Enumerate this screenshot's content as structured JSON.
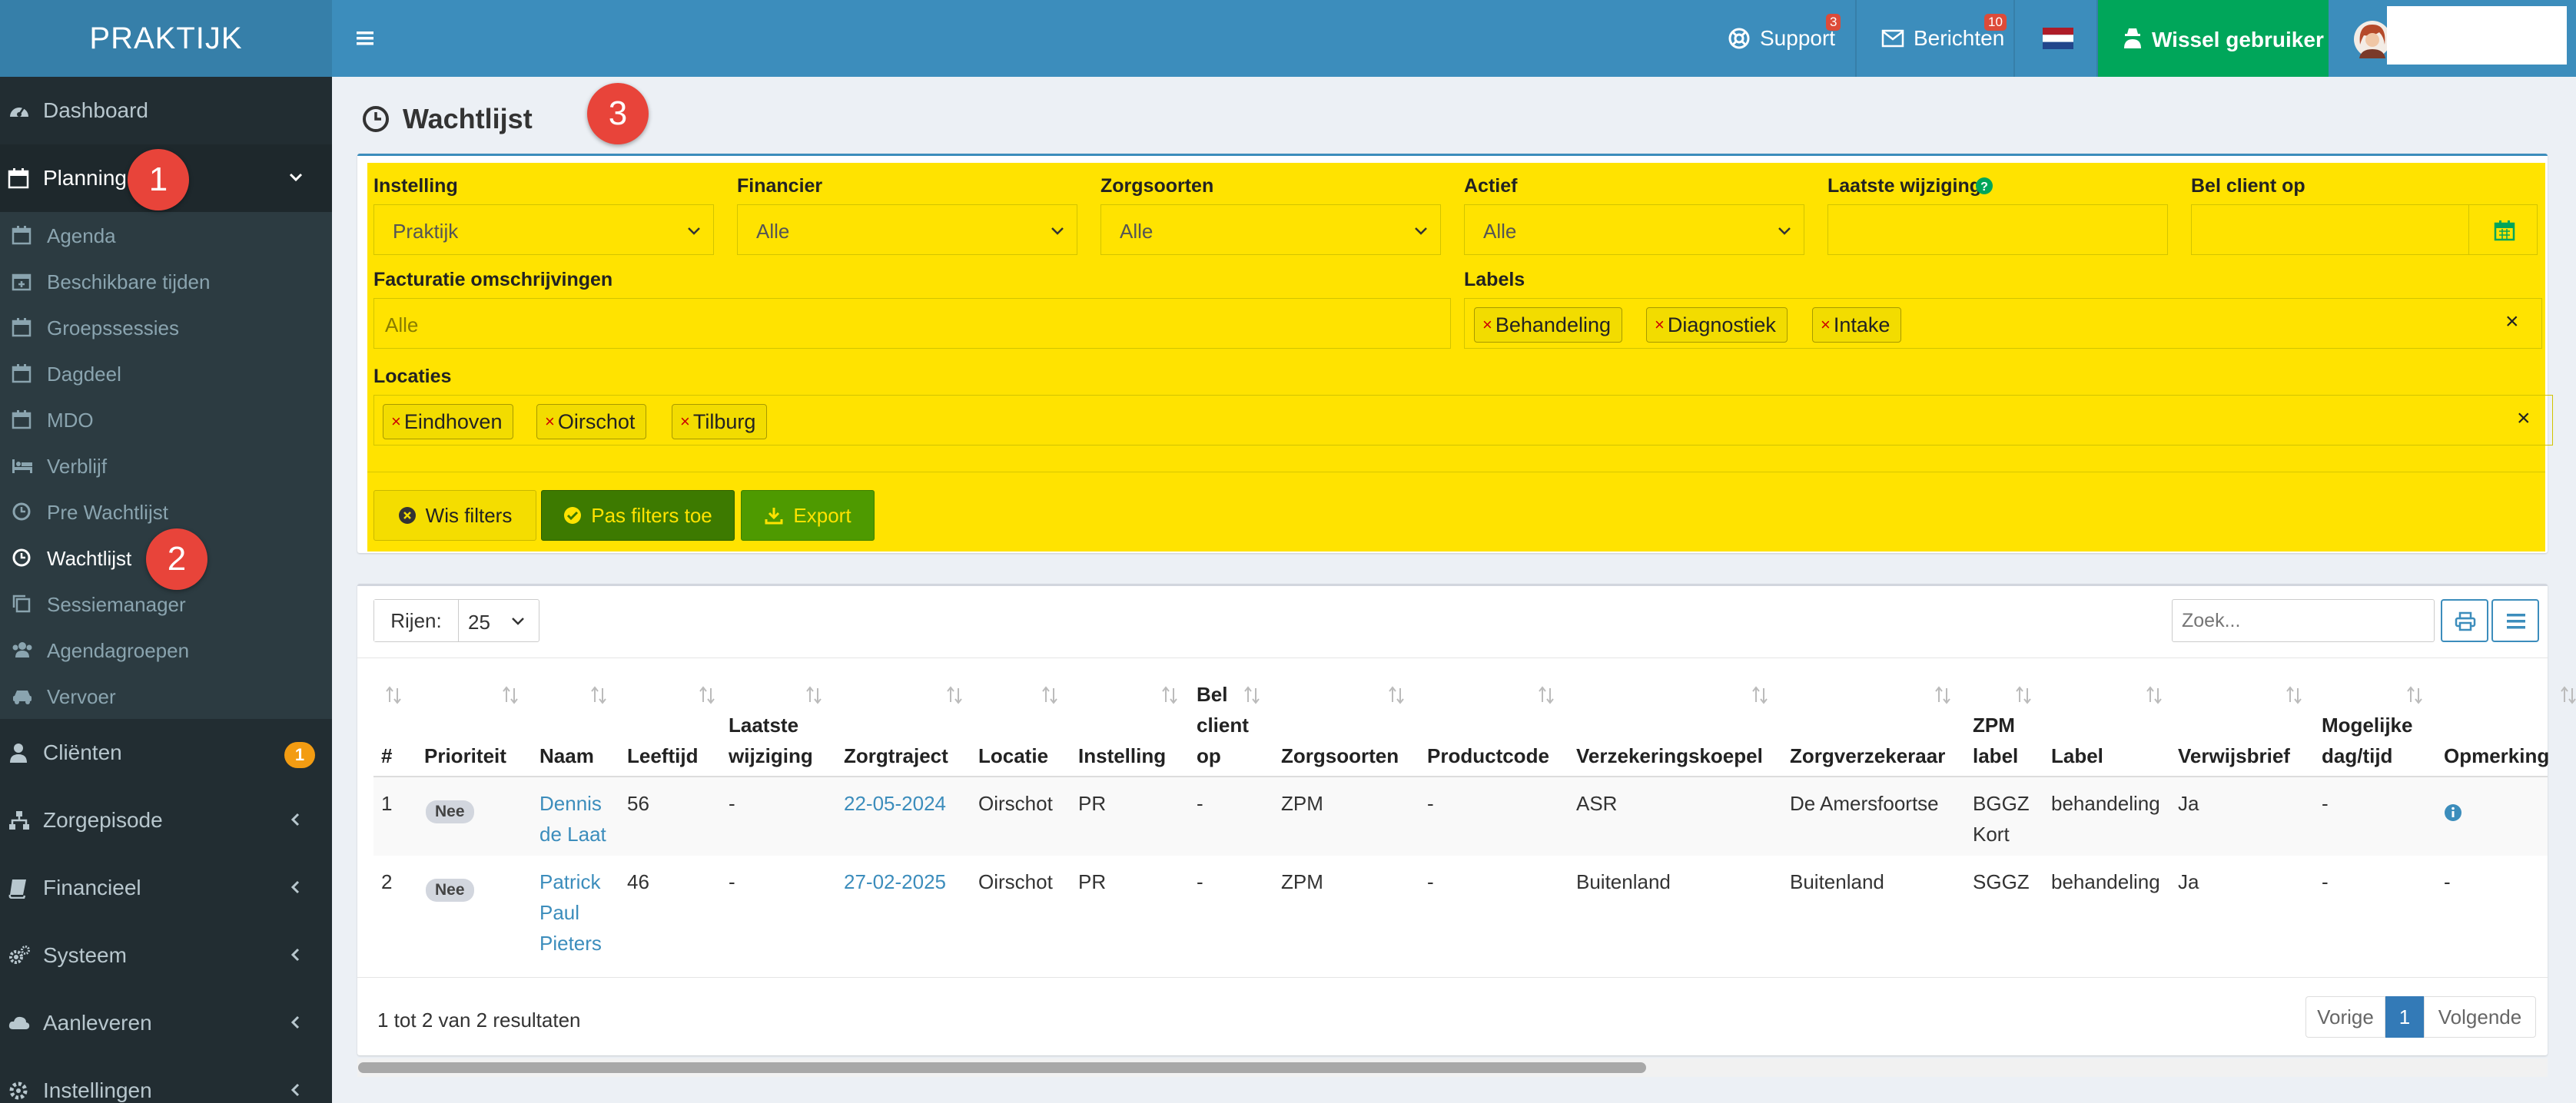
{
  "app": {
    "brand": "PRAKTIJK"
  },
  "colors": {
    "topbar": "#3c8dbc",
    "sidebar": "#222d32",
    "accent_green": "#00a65a",
    "highlight_yellow": "#ffe300",
    "marker_red": "#e8443a",
    "link_blue": "#3c8dbc"
  },
  "sidebar": {
    "top_items": [
      {
        "label": "Dashboard",
        "icon": "dashboard-icon"
      },
      {
        "label": "Planning",
        "icon": "calendar-icon",
        "expanded": true
      },
      {
        "label": "Cliënten",
        "icon": "user-icon",
        "badge": "1"
      },
      {
        "label": "Zorgepisode",
        "icon": "sitemap-icon"
      },
      {
        "label": "Financieel",
        "icon": "book-icon"
      },
      {
        "label": "Systeem",
        "icon": "cogs-icon"
      },
      {
        "label": "Aanleveren",
        "icon": "cloud-icon"
      },
      {
        "label": "Instellingen",
        "icon": "gear-icon"
      }
    ],
    "planning_items": [
      {
        "label": "Agenda",
        "icon": "calendar-icon"
      },
      {
        "label": "Beschikbare tijden",
        "icon": "calendar-plus-icon"
      },
      {
        "label": "Groepssessies",
        "icon": "calendar-icon"
      },
      {
        "label": "Dagdeel",
        "icon": "calendar-icon"
      },
      {
        "label": "MDO",
        "icon": "calendar-icon"
      },
      {
        "label": "Verblijf",
        "icon": "bed-icon"
      },
      {
        "label": "Pre Wachtlijst",
        "icon": "clock-icon"
      },
      {
        "label": "Wachtlijst",
        "icon": "clock-icon",
        "active": true
      },
      {
        "label": "Sessiemanager",
        "icon": "copy-icon"
      },
      {
        "label": "Agendagroepen",
        "icon": "users-icon"
      },
      {
        "label": "Vervoer",
        "icon": "car-icon"
      }
    ]
  },
  "markers": [
    "1",
    "2",
    "3"
  ],
  "topbar": {
    "support_label": "Support",
    "support_badge": "3",
    "berichten_label": "Berichten",
    "berichten_badge": "10",
    "wissel_label": "Wissel gebruiker"
  },
  "page": {
    "title": "Wachtlijst"
  },
  "filters": {
    "instelling": {
      "label": "Instelling",
      "value": "Praktijk"
    },
    "financier": {
      "label": "Financier",
      "value": "Alle"
    },
    "zorgsoorten": {
      "label": "Zorgsoorten",
      "value": "Alle"
    },
    "actief": {
      "label": "Actief",
      "value": "Alle"
    },
    "laatste_wijziging": {
      "label": "Laatste wijziging",
      "value": ""
    },
    "bel_client_op": {
      "label": "Bel client op",
      "value": ""
    },
    "facturatie": {
      "label": "Facturatie omschrijvingen",
      "placeholder": "Alle"
    },
    "labels": {
      "label": "Labels",
      "tags": [
        "Behandeling",
        "Diagnostiek",
        "Intake"
      ]
    },
    "locaties": {
      "label": "Locaties",
      "tags": [
        "Eindhoven",
        "Oirschot",
        "Tilburg"
      ]
    },
    "tag_remove": "×",
    "clear_all": "×",
    "buttons": {
      "wis": "Wis filters",
      "pas_toe": "Pas filters toe",
      "export": "Export"
    }
  },
  "table_controls": {
    "rows_label": "Rijen:",
    "rows_value": "25",
    "search_placeholder": "Zoek..."
  },
  "table": {
    "headers": [
      [
        "#"
      ],
      [
        "Prioriteit"
      ],
      [
        "Naam"
      ],
      [
        "Leeftijd"
      ],
      [
        "Laatste",
        "wijziging"
      ],
      [
        "Zorgtraject"
      ],
      [
        "Locatie"
      ],
      [
        "Instelling"
      ],
      [
        "Bel",
        "client",
        "op"
      ],
      [
        "Zorgsoorten"
      ],
      [
        "Productcode"
      ],
      [
        "Verzekeringskoepel"
      ],
      [
        "Zorgverzekeraar"
      ],
      [
        "ZPM",
        "label"
      ],
      [
        "Label"
      ],
      [
        "Verwijsbrief"
      ],
      [
        "Mogelijke",
        "dag/tijd"
      ],
      [
        "Opmerking"
      ]
    ],
    "rows": [
      {
        "num": "1",
        "prioriteit": "Nee",
        "naam": [
          "Dennis",
          "de Laat"
        ],
        "leeftijd": "56",
        "laatste_wijziging": "-",
        "zorgtraject": "22-05-2024",
        "locatie": "Oirschot",
        "instelling": "PR",
        "bel_client_op": "-",
        "zorgsoorten": "ZPM",
        "productcode": "-",
        "verzekeringskoepel": "ASR",
        "zorgverzekeraar": "De Amersfoortse",
        "zpm_label": [
          "BGGZ",
          "Kort"
        ],
        "label": "behandeling",
        "verwijsbrief": "Ja",
        "mogelijke": "-",
        "opmerking": "info-icon"
      },
      {
        "num": "2",
        "prioriteit": "Nee",
        "naam": [
          "Patrick",
          "Paul",
          "Pieters"
        ],
        "leeftijd": "46",
        "laatste_wijziging": "-",
        "zorgtraject": "27-02-2025",
        "locatie": "Oirschot",
        "instelling": "PR",
        "bel_client_op": "-",
        "zorgsoorten": "ZPM",
        "productcode": "-",
        "verzekeringskoepel": "Buitenland",
        "zorgverzekeraar": "Buitenland",
        "zpm_label": [
          "SGGZ"
        ],
        "label": "behandeling",
        "verwijsbrief": "Ja",
        "mogelijke": "-",
        "opmerking": "-"
      }
    ],
    "summary": "1 tot 2 van 2 resultaten",
    "pagination": {
      "prev": "Vorige",
      "current": "1",
      "next": "Volgende"
    }
  }
}
